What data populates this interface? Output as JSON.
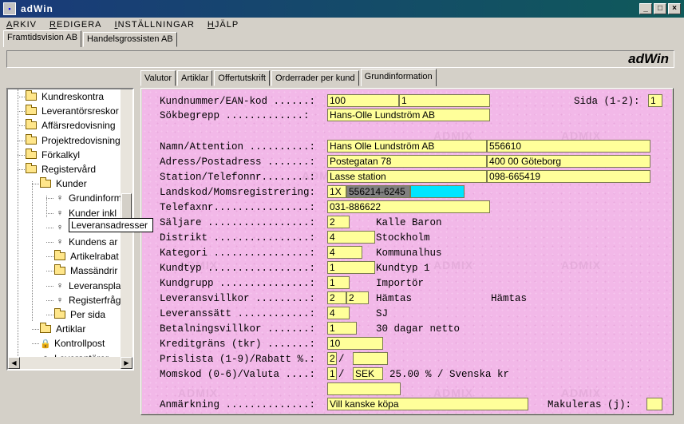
{
  "window": {
    "title": "adWin",
    "min": "_",
    "max": "□",
    "close": "×"
  },
  "menu": [
    {
      "u": "A",
      "rest": "RKIV"
    },
    {
      "u": "R",
      "rest": "EDIGERA"
    },
    {
      "u": "I",
      "rest": "NSTÄLLNINGAR"
    },
    {
      "u": "H",
      "rest": "JÄLP"
    }
  ],
  "company_tabs": [
    "Framtidsvision AB",
    "Handelsgrossisten AB"
  ],
  "brand": "adWin",
  "tree": {
    "items": [
      {
        "label": "Kundreskontra",
        "icon": "folder"
      },
      {
        "label": "Leverantörsreskor",
        "icon": "folder"
      },
      {
        "label": "Affärsredovisning",
        "icon": "folder"
      },
      {
        "label": "Projektredovisning",
        "icon": "folder"
      },
      {
        "label": "Förkalkyl",
        "icon": "folder"
      },
      {
        "label": "Registervård",
        "icon": "folder"
      },
      {
        "label": "Kunder",
        "icon": "folder"
      },
      {
        "label": "Grundinform",
        "icon": "bulb"
      },
      {
        "label": "Kunder inkl",
        "icon": "bulb"
      },
      {
        "label": "Leveransadresser",
        "icon": "bulb"
      },
      {
        "label": "Kundens ar",
        "icon": "bulb"
      },
      {
        "label": "Artikelrabat",
        "icon": "folder"
      },
      {
        "label": "Massändrir",
        "icon": "folder"
      },
      {
        "label": "Leveranspla",
        "icon": "bulb"
      },
      {
        "label": "Registerfråg",
        "icon": "bulb"
      },
      {
        "label": "Per sida",
        "icon": "folder"
      },
      {
        "label": "Artiklar",
        "icon": "folder"
      },
      {
        "label": "Kontrollpost",
        "icon": "lock"
      },
      {
        "label": "Leverantörer",
        "icon": "bulb"
      }
    ],
    "tooltip": "Leveransadresser"
  },
  "subtabs": [
    "Valutor",
    "Artiklar",
    "Offertutskrift",
    "Orderrader per kund",
    "Grundinformation"
  ],
  "form": {
    "labels": {
      "kundnummer": "Kundnummer/EAN-kod ......:",
      "sida": "Sida (1-2):",
      "sokbegrepp": "Sökbegrepp .............:",
      "namn": "Namn/Attention ..........:",
      "adress": "Adress/Postadress .......:",
      "station": "Station/Telefonnr........:",
      "landskod": "Landskod/Momsregistrering:",
      "telefax": "Telefaxnr................:",
      "saljare": "Säljare .................:",
      "distrikt": "Distrikt ................:",
      "kategori": "Kategori ................:",
      "kundtyp": "Kundtyp .................:",
      "kundgrupp": "Kundgrupp ...............:",
      "leveransvillkor": "Leveransvillkor .........:",
      "leveranssatt": "Leveranssätt ............:",
      "betalning": "Betalningsvillkor .......:",
      "kredit": "Kreditgräns (tkr) .......:",
      "prislista": "Prislista (1-9)/Rabatt %.:",
      "momskod": "Momskod (0-6)/Valuta ....:",
      "anmarkning": "Anmärkning ..............:",
      "makuleras": "Makuleras (j):"
    },
    "values": {
      "kundnummer": "100",
      "ean": "1",
      "sida": "1",
      "sokbegrepp": "Hans-Olle Lundström AB",
      "namn": "Hans Olle Lundström AB",
      "attention": "556610",
      "adress": "Postegatan 78",
      "postadress": "400 00 Göteborg",
      "station": "Lasse station",
      "telefon": "098-665419",
      "landskod": "1X",
      "momsreg": "556214-6245",
      "telefax": "031-886622",
      "saljare": "2",
      "saljare_text": "Kalle Baron",
      "distrikt": "4",
      "distrikt_text": "Stockholm",
      "kategori": "4",
      "kategori_text": "Kommunalhus",
      "kundtyp": "1",
      "kundtyp_text": "Kundtyp 1",
      "kundgrupp": "1",
      "kundgrupp_text": "Importör",
      "lev1": "2",
      "lev2": "2",
      "lev_text1": "Hämtas",
      "lev_text2": "Hämtas",
      "leveranssatt": "4",
      "leveranssatt_text": "SJ",
      "betalning": "1",
      "betalning_text": "30 dagar netto",
      "kredit": "10",
      "prislista": "2",
      "slash1": "/",
      "rabatt": "",
      "momskod": "1",
      "slash2": "/",
      "valuta": "SEK",
      "moms_text": "25.00 % / Svenska kr",
      "extra": "",
      "anmarkning": "Vill kanske köpa",
      "makuleras": ""
    }
  },
  "watermark": "ADMIX"
}
